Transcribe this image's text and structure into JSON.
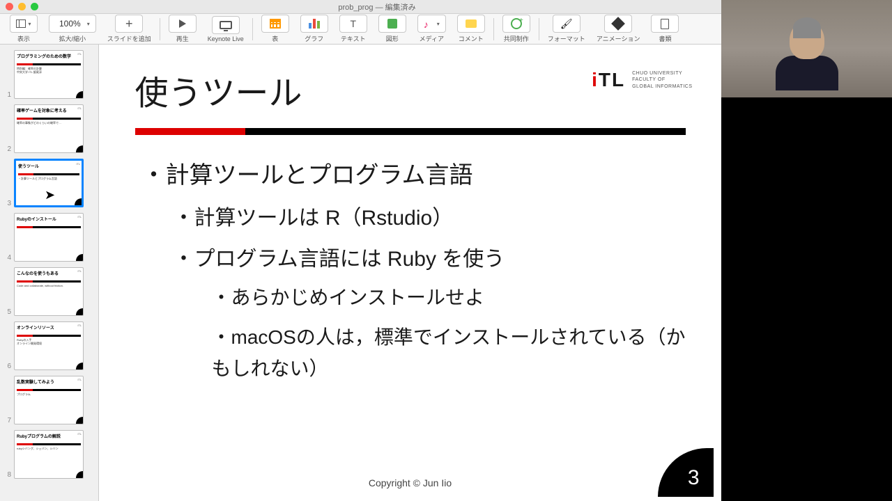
{
  "window": {
    "title": "prob_prog — 編集済み"
  },
  "toolbar": {
    "zoom": "100%",
    "view": "表示",
    "zoomLabel": "拡大/縮小",
    "addSlide": "スライドを追加",
    "play": "再生",
    "keynoteLive": "Keynote Live",
    "table": "表",
    "chart": "グラフ",
    "text": "テキスト",
    "shape": "図形",
    "media": "メディア",
    "comment": "コメント",
    "collaborate": "共同制作",
    "format": "フォーマット",
    "animation": "アニメーション",
    "document": "書類"
  },
  "thumbnails": [
    {
      "num": "1",
      "title": "プログラミングのための数学",
      "body": "特別編：確率の計算\n中央大学 ITL 飯尾淳"
    },
    {
      "num": "2",
      "title": "確率ゲームを対象に考える",
      "body": "確率の事象がどのくらいの確率で…"
    },
    {
      "num": "3",
      "title": "使うツール",
      "body": "・計算ツールとプログラム言語",
      "selected": true
    },
    {
      "num": "4",
      "title": "Rubyのインストール",
      "body": ""
    },
    {
      "num": "5",
      "title": "こんなのを使うもある",
      "body": "Code and collaborate, without friction."
    },
    {
      "num": "6",
      "title": "オンラインリソース",
      "body": "Rubyの入手\nオンライン開発環境"
    },
    {
      "num": "7",
      "title": "乱数実験してみよう",
      "body": "プログラム"
    },
    {
      "num": "8",
      "title": "Rubyプログラムの解説",
      "body": "rubyシバング、シェバン、シバン"
    }
  ],
  "slide": {
    "title": "使うツール",
    "logo": {
      "brand": "iTL",
      "sub1": "CHUO UNIVERSITY",
      "sub2": "FACULTY OF",
      "sub3": "GLOBAL INFORMATICS"
    },
    "bullets": {
      "b1": "・計算ツールとプログラム言語",
      "b2a": "・計算ツールは R（Rstudio）",
      "b2b": "・プログラム言語には Ruby を使う",
      "b3a": "・あらかじめインストールせよ",
      "b3b": "・macOSの人は，標準でインストールされている（かもしれない）"
    },
    "copyright": "Copyright © Jun Iio",
    "pageNum": "3"
  }
}
